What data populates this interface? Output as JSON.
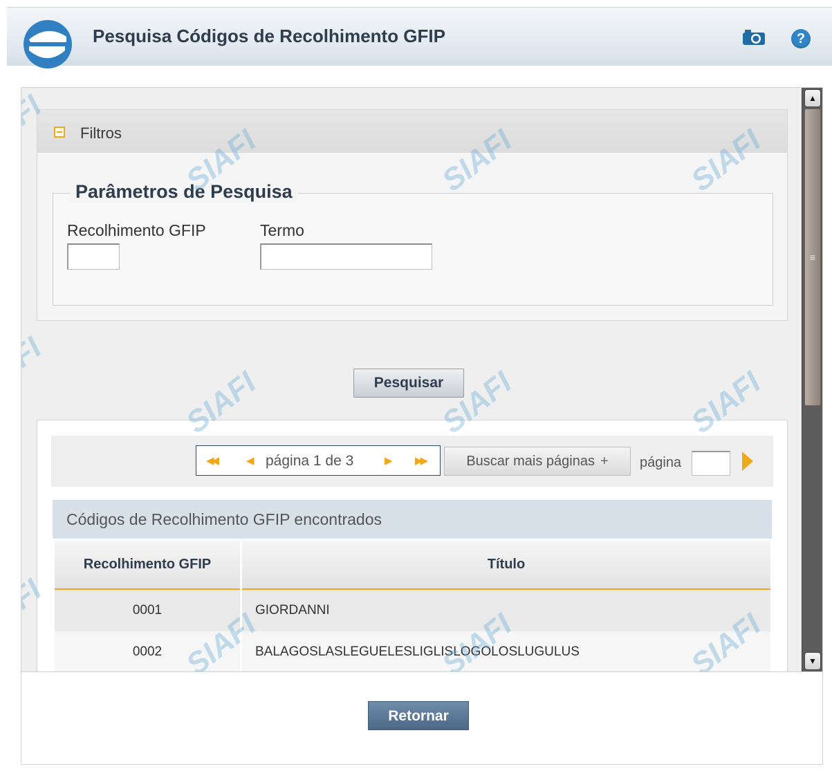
{
  "header": {
    "title": "Pesquisa Códigos de Recolhimento GFIP",
    "help_glyph": "?",
    "icons": [
      "siafi-logo-icon",
      "camera-icon",
      "help-icon"
    ]
  },
  "filters": {
    "label": "Filtros",
    "fieldset_legend": "Parâmetros de Pesquisa",
    "field_codigo_label": "Recolhimento GFIP",
    "field_codigo_value": "",
    "field_termo_label": "Termo",
    "field_termo_value": "",
    "search_button": "Pesquisar"
  },
  "pager": {
    "first_glyph": "◀◀",
    "prev_glyph": "◀",
    "page_text": "página 1 de 3",
    "next_glyph": "▶",
    "last_glyph": "▶▶",
    "more_pages_button": "Buscar mais páginas",
    "more_pages_icon": "+",
    "page_label": "página",
    "page_input_value": ""
  },
  "results": {
    "caption": "Códigos de Recolhimento GFIP encontrados",
    "columns": [
      "Recolhimento GFIP",
      "Título"
    ],
    "rows": [
      {
        "codigo": "0001",
        "titulo": "GIORDANNI"
      },
      {
        "codigo": "0002",
        "titulo": "BALAGOSLASLEGUELESLIGLISLOGOLOSLUGULUS"
      }
    ]
  },
  "footer": {
    "return_button": "Retornar"
  },
  "watermark_text": "SIAFI",
  "colors": {
    "accent_orange": "#f0a81b",
    "title_navy": "#2d3d4e",
    "help_blue": "#2f85c6",
    "caption_bg": "#d8e1e9"
  }
}
